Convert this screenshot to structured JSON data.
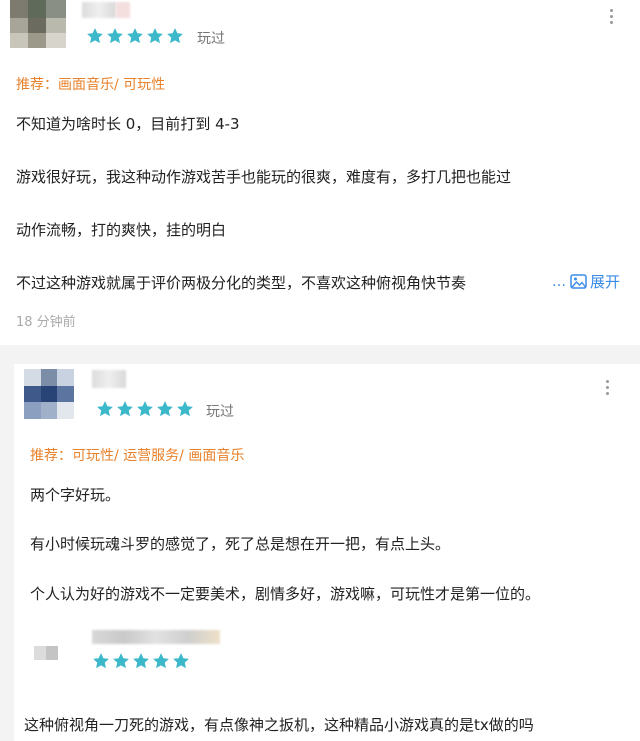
{
  "colors": {
    "star": "#3bb8c9",
    "tag": "#e8822c",
    "link": "#3a8be8"
  },
  "reviews": [
    {
      "rating": 5,
      "played_label": "玩过",
      "tags": "推荐：画面音乐/ 可玩性",
      "lines": [
        "不知道为啥时长 0，目前打到 4-3",
        "游戏很好玩，我这种动作游戏苦手也能玩的很爽，难度有，多打几把也能过",
        "动作流畅，打的爽快，挂的明白",
        "不过这种游戏就属于评价两极分化的类型，不喜欢这种俯视角快节奏"
      ],
      "expand_label": "展开",
      "time": "18 分钟前"
    },
    {
      "rating": 5,
      "played_label": "玩过",
      "tags": "推荐：可玩性/ 运营服务/ 画面音乐",
      "lines": [
        "两个字好玩。",
        "有小时候玩魂斗罗的感觉了，死了总是想在开一把，有点上头。",
        "个人认为好的游戏不一定要美术，剧情多好，游戏嘛，可玩性才是第一位的。"
      ]
    },
    {
      "rating": 5,
      "lines": [
        "这种俯视角一刀死的游戏，有点像神之扳机，这种精品小游戏真的是tx做的吗"
      ]
    }
  ]
}
